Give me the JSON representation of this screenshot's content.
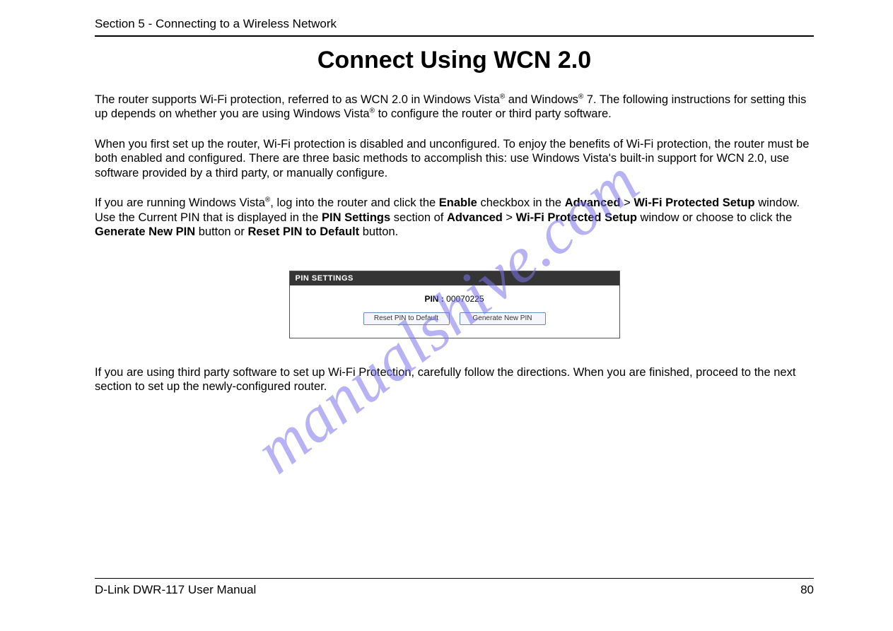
{
  "section_header": "Section 5 - Connecting to a Wireless Network",
  "title": "Connect Using WCN 2.0",
  "para1_a": "The router supports Wi-Fi protection, referred to as WCN 2.0 in Windows Vista",
  "para1_b": " and Windows",
  "para1_c": " 7. The following instructions for setting this up depends on whether you are using Windows Vista",
  "para1_d": " to configure the router or third party software.",
  "para2": "When you first set up the router, Wi-Fi protection is disabled and unconfigured. To enjoy the benefits of Wi-Fi protection, the router must be both enabled and configured. There are three basic methods to accomplish this: use Windows Vista's built-in support for WCN 2.0, use software provided by a third party, or manually configure.",
  "para3_a": "If you are running Windows Vista",
  "para3_b": ", log into the router and click the ",
  "para3_enable": "Enable",
  "para3_c": " checkbox in the ",
  "para3_adv": "Advanced",
  "para3_gt": " > ",
  "para3_wps": "Wi-Fi Protected Setup",
  "para3_d": " window. Use the Current PIN that is displayed in the ",
  "para3_pinset": "PIN Settings",
  "para3_e": " section of ",
  "para3_f": " window or choose to click the ",
  "para3_gen": "Generate New PIN",
  "para3_g": " button or ",
  "para3_reset": "Reset PIN to Default",
  "para3_h": " button.",
  "pin_panel": {
    "header": "PIN SETTINGS",
    "pin_label": "PIN :",
    "pin_value": "00070225",
    "btn_reset": "Reset PIN to Default",
    "btn_generate": "Generate New PIN"
  },
  "para4": "If you are using third party software to set up Wi-Fi Protection, carefully follow the directions. When you are finished, proceed to the next section to set up the newly-configured router.",
  "footer_left": "D-Link DWR-117 User Manual",
  "footer_right": "80",
  "watermark": "manualshive.com",
  "reg_mark": "®"
}
